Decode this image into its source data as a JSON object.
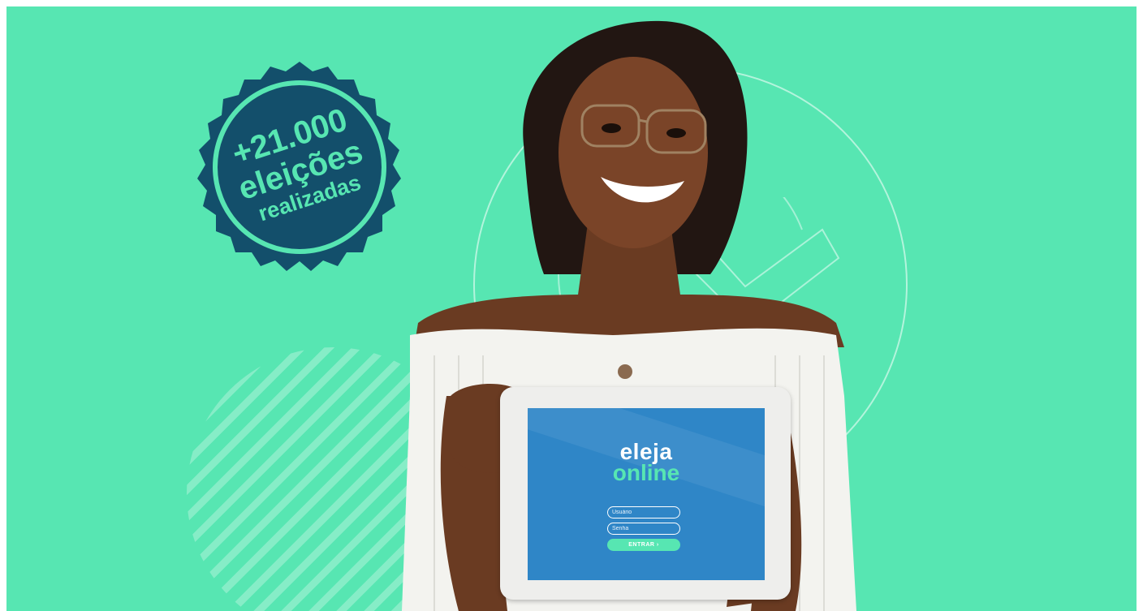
{
  "stamp": {
    "count": "+21.000",
    "word": "eleições",
    "caption": "realizadas",
    "color": "#134f6b"
  },
  "tablet": {
    "logo_line1": "eleja",
    "logo_line2": "online",
    "user_placeholder": "Usuário",
    "password_placeholder": "Senha",
    "enter_label": "ENTRAR ›"
  },
  "colors": {
    "background": "#57e6b2",
    "screen": "#2f86c7",
    "accent": "#57e6b2"
  },
  "icons": [
    "checkmark-icon",
    "badge-stamp"
  ]
}
